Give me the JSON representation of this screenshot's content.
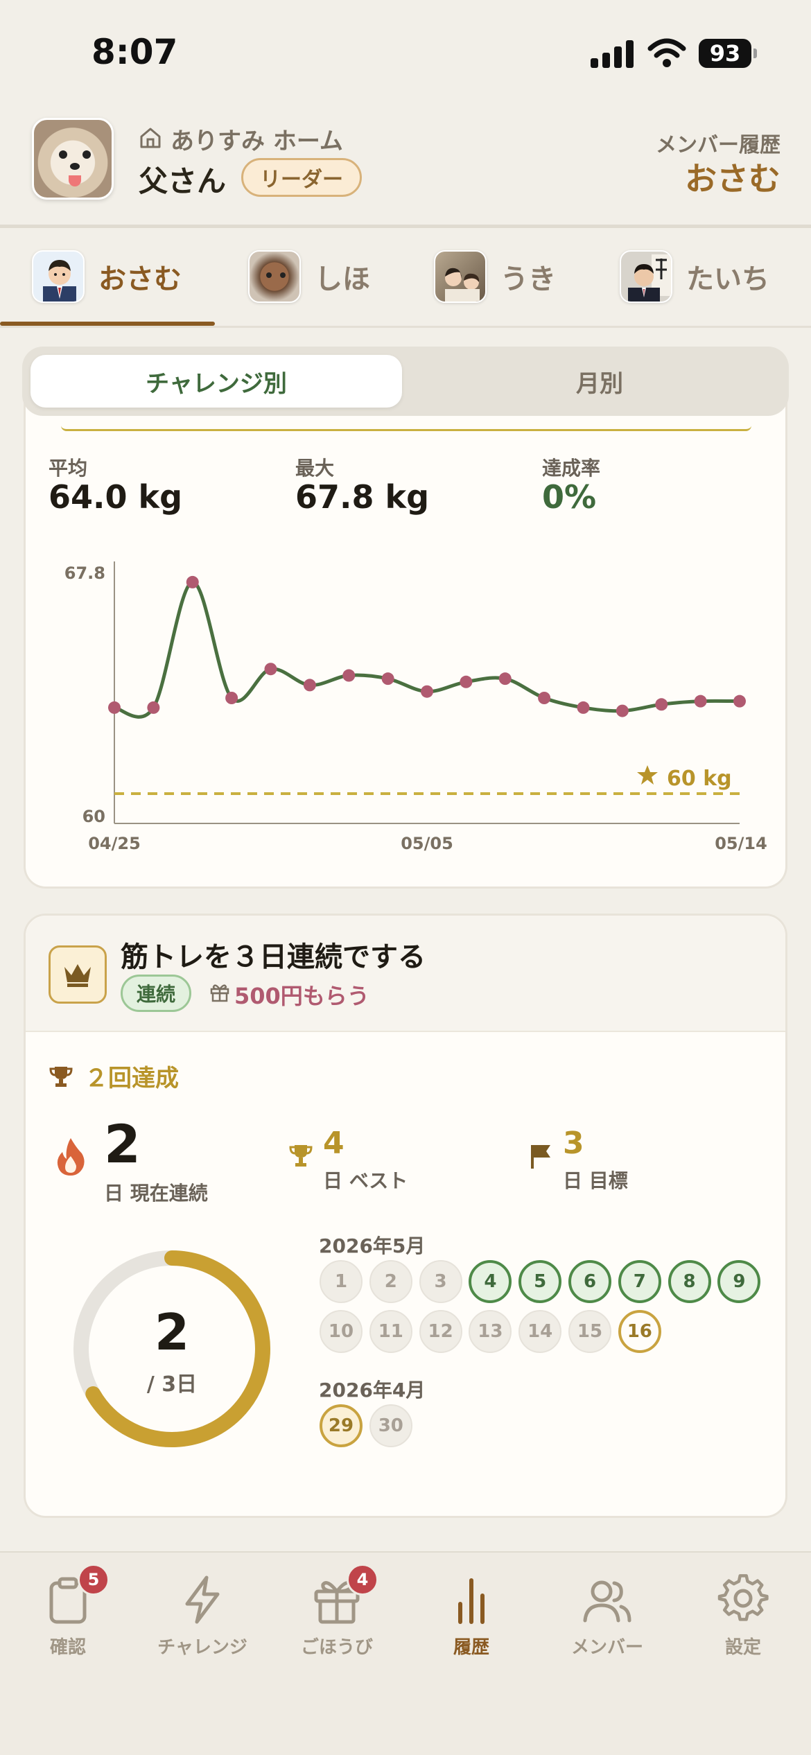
{
  "status_bar": {
    "time": "8:07",
    "battery": "93"
  },
  "header": {
    "home_name": "ありすみ ホーム",
    "user_name": "父さん",
    "role_badge": "リーダー",
    "history_label": "メンバー履歴",
    "history_member": "おさむ"
  },
  "members": [
    {
      "name": "おさむ",
      "active": true
    },
    {
      "name": "しほ",
      "active": false
    },
    {
      "name": "うき",
      "active": false
    },
    {
      "name": "たいち",
      "active": false
    }
  ],
  "view_toggle": {
    "by_challenge": "チャレンジ別",
    "by_month": "月別",
    "selected": "チャレンジ別"
  },
  "stats": {
    "avg_label": "平均",
    "avg_value": "64.0 kg",
    "max_label": "最大",
    "max_value": "67.8 kg",
    "rate_label": "達成率",
    "rate_value": "0%"
  },
  "chart_data": {
    "type": "line",
    "x": [
      "04/25",
      "04/26",
      "04/27",
      "04/28",
      "04/29",
      "04/30",
      "05/01",
      "05/02",
      "05/03",
      "05/05",
      "05/06",
      "05/07",
      "05/09",
      "05/10",
      "05/11",
      "05/13",
      "05/14"
    ],
    "values": [
      63.6,
      63.6,
      67.5,
      63.9,
      64.8,
      64.3,
      64.6,
      64.5,
      64.1,
      64.4,
      64.5,
      63.9,
      63.6,
      63.5,
      63.7,
      63.8,
      63.8
    ],
    "ylim": [
      60,
      67.8
    ],
    "y_ticks": [
      "67.8",
      "60"
    ],
    "x_ticks": [
      "04/25",
      "05/05",
      "05/14"
    ],
    "target": {
      "value": 60,
      "label": "60 kg"
    },
    "colors": {
      "line": "#4a7040",
      "point": "#b05a70",
      "target": "#c9b040"
    }
  },
  "challenge": {
    "title": "筋トレを３日連続でする",
    "tag": "連続",
    "reward": "500円もらう",
    "achieved": "２回達成",
    "current_streak": "2",
    "current_label": "日 現在連続",
    "best": "4",
    "best_label": "日 ベスト",
    "goal": "3",
    "goal_label": "日 目標",
    "progress_num": "2",
    "progress_sub": "/ 3日",
    "progress_fraction": 0.667
  },
  "calendar": {
    "may_label": "2026年5月",
    "may_days": [
      {
        "d": "1",
        "s": "miss"
      },
      {
        "d": "2",
        "s": "miss"
      },
      {
        "d": "3",
        "s": "miss"
      },
      {
        "d": "4",
        "s": "done"
      },
      {
        "d": "5",
        "s": "done"
      },
      {
        "d": "6",
        "s": "done"
      },
      {
        "d": "7",
        "s": "done"
      },
      {
        "d": "8",
        "s": "done"
      },
      {
        "d": "9",
        "s": "done"
      },
      {
        "d": "10",
        "s": "miss"
      },
      {
        "d": "11",
        "s": "miss"
      },
      {
        "d": "12",
        "s": "miss"
      },
      {
        "d": "13",
        "s": "miss"
      },
      {
        "d": "14",
        "s": "miss"
      },
      {
        "d": "15",
        "s": "miss"
      },
      {
        "d": "16",
        "s": "today"
      }
    ],
    "april_label": "2026年4月",
    "april_days": [
      {
        "d": "29",
        "s": "start"
      },
      {
        "d": "30",
        "s": "miss"
      }
    ]
  },
  "nav": [
    {
      "label": "確認",
      "icon": "clipboard-icon",
      "badge": "5"
    },
    {
      "label": "チャレンジ",
      "icon": "lightning-icon",
      "badge": ""
    },
    {
      "label": "ごほうび",
      "icon": "gift-icon",
      "badge": "4"
    },
    {
      "label": "履歴",
      "icon": "bar-chart-icon",
      "badge": "",
      "active": true
    },
    {
      "label": "メンバー",
      "icon": "members-icon",
      "badge": ""
    },
    {
      "label": "設定",
      "icon": "gear-icon",
      "badge": ""
    }
  ]
}
